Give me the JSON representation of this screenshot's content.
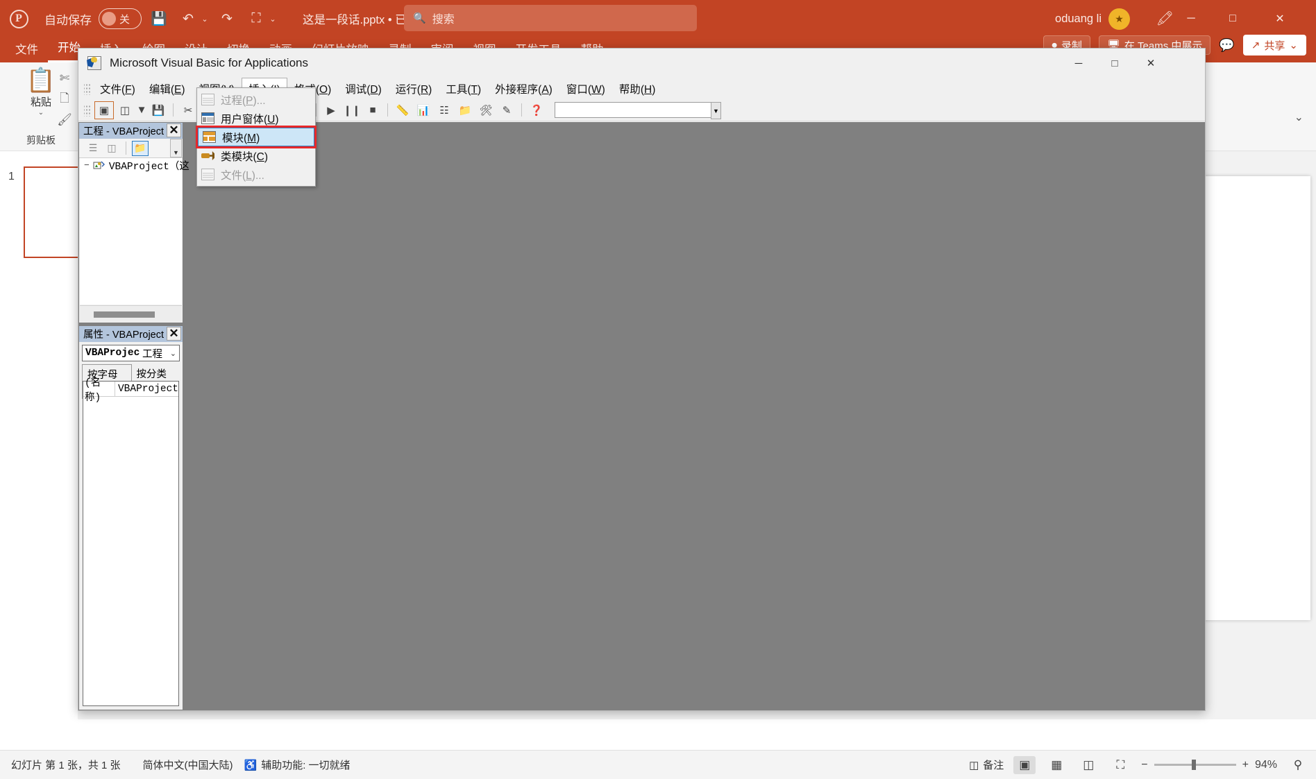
{
  "powerpoint": {
    "brand_color": "#c24424",
    "titlebar": {
      "logo": "powerpoint-logo",
      "autosave_label": "自动保存",
      "autosave_state": "关",
      "save_icon": "save-icon",
      "undo_icon": "undo-icon",
      "redo_icon": "redo-icon",
      "present_icon": "start-presentation-icon",
      "customize_caret": "⌄",
      "document_title": "这是一段话.pptx • 已保存到这台电脑",
      "title_caret": "⌄",
      "user_name": "oduang li",
      "avatar_initial": "★",
      "pen_icon": "pen-icon",
      "minimize": "─",
      "maximize": "□",
      "close": "✕"
    },
    "search": {
      "icon": "search-icon",
      "placeholder": "搜索",
      "value": ""
    },
    "ribbon_tabs": [
      {
        "label": "文件",
        "active": false
      },
      {
        "label": "开始",
        "active": true
      },
      {
        "label": "插入",
        "active": false
      },
      {
        "label": "绘图",
        "active": false
      },
      {
        "label": "设计",
        "active": false
      },
      {
        "label": "切换",
        "active": false
      },
      {
        "label": "动画",
        "active": false
      },
      {
        "label": "幻灯片放映",
        "active": false
      },
      {
        "label": "录制",
        "active": false
      },
      {
        "label": "审阅",
        "active": false
      },
      {
        "label": "视图",
        "active": false
      },
      {
        "label": "开发工具",
        "active": false
      },
      {
        "label": "帮助",
        "active": false
      }
    ],
    "ribbon_right": {
      "record_label": "录制",
      "record_icon": "record-icon",
      "teams_label": "在 Teams 中展示",
      "teams_icon": "teams-icon",
      "comments_icon": "comments-icon",
      "share_label": "共享",
      "share_icon": "share-icon",
      "share_caret": "⌄"
    },
    "clipboard_group": {
      "paste_icon": "paste-icon",
      "paste_label": "粘贴",
      "paste_caret": "⌄",
      "cut_icon": "scissors-icon",
      "copy_icon": "copy-icon",
      "format_painter_icon": "format-painter-icon",
      "group_label": "剪贴板",
      "expander_icon": "chevron-down-icon"
    },
    "thumbnail": {
      "number": "1"
    },
    "statusbar": {
      "slide_info": "幻灯片 第 1 张，共 1 张",
      "language": "简体中文(中国大陆)",
      "accessibility_icon": "accessibility-icon",
      "accessibility": "辅助功能: 一切就绪",
      "notes_icon": "notes-icon",
      "notes_label": "备注",
      "view_normal_icon": "normal-view-icon",
      "view_sorter_icon": "slide-sorter-icon",
      "view_reading_icon": "reading-view-icon",
      "view_show_icon": "slideshow-icon",
      "zoom_out": "−",
      "zoom_in": "+",
      "zoom_level": "94%",
      "fit_icon": "fit-to-window-icon"
    }
  },
  "vba": {
    "titlebar": {
      "icon": "vba-icon",
      "title": "Microsoft Visual Basic for Applications",
      "minimize": "─",
      "maximize": "□",
      "close": "✕"
    },
    "menubar": [
      {
        "label": "文件",
        "accel": "F",
        "open": false
      },
      {
        "label": "编辑",
        "accel": "E",
        "open": false
      },
      {
        "label": "视图",
        "accel": "V",
        "open": false
      },
      {
        "label": "插入",
        "accel": "I",
        "open": true
      },
      {
        "label": "格式",
        "accel": "O",
        "open": false
      },
      {
        "label": "调试",
        "accel": "D",
        "open": false
      },
      {
        "label": "运行",
        "accel": "R",
        "open": false
      },
      {
        "label": "工具",
        "accel": "T",
        "open": false
      },
      {
        "label": "外接程序",
        "accel": "A",
        "open": false
      },
      {
        "label": "窗口",
        "accel": "W",
        "open": false
      },
      {
        "label": "帮助",
        "accel": "H",
        "open": false
      }
    ],
    "toolbar": {
      "buttons": [
        "view-host-icon",
        "insert-object-icon",
        "insert-dropdown-caret",
        "save-icon",
        "cut-icon",
        "copy-icon",
        "paste-icon",
        "find-icon",
        "undo-icon",
        "redo-icon",
        "run-icon",
        "break-icon",
        "reset-icon",
        "design-mode-icon",
        "project-explorer-icon",
        "properties-window-icon",
        "object-browser-icon",
        "toolbox-icon",
        "help-icon"
      ],
      "position_value": "",
      "dropdown_caret": "▼"
    },
    "insert_menu": {
      "items": [
        {
          "label": "过程",
          "accel": "P",
          "suffix": "...",
          "icon": "procedure-icon",
          "disabled": true,
          "highlighted": false
        },
        {
          "label": "用户窗体",
          "accel": "U",
          "suffix": "",
          "icon": "userform-icon",
          "disabled": false,
          "highlighted": false
        },
        {
          "label": "模块",
          "accel": "M",
          "suffix": "",
          "icon": "module-icon",
          "disabled": false,
          "highlighted": true
        },
        {
          "label": "类模块",
          "accel": "C",
          "suffix": "",
          "icon": "class-module-icon",
          "disabled": false,
          "highlighted": false
        },
        {
          "label": "文件",
          "accel": "L",
          "suffix": "...",
          "icon": "file-icon",
          "disabled": true,
          "highlighted": false
        }
      ]
    },
    "project_pane": {
      "title": "工程 - VBAProject",
      "close": "✕",
      "toolbar_buttons": [
        {
          "name": "view-code-icon",
          "selected": false
        },
        {
          "name": "view-object-icon",
          "selected": false
        },
        {
          "name": "toggle-folders-icon",
          "selected": true
        }
      ],
      "scroll_icon": "scroll-up-icon",
      "tree": [
        {
          "prefix": "−",
          "icon": "project-icon",
          "label": "VBAProject（这"
        }
      ]
    },
    "properties_pane": {
      "title": "属性 - VBAProject",
      "close": "✕",
      "combo_name": "VBAProject",
      "combo_kind": "工程",
      "combo_caret": "⌄",
      "tabs": [
        {
          "label": "按字母序",
          "active": true
        },
        {
          "label": "按分类序",
          "active": false
        }
      ],
      "rows": [
        {
          "key": "(名称)",
          "value": "VBAProject"
        }
      ]
    }
  }
}
